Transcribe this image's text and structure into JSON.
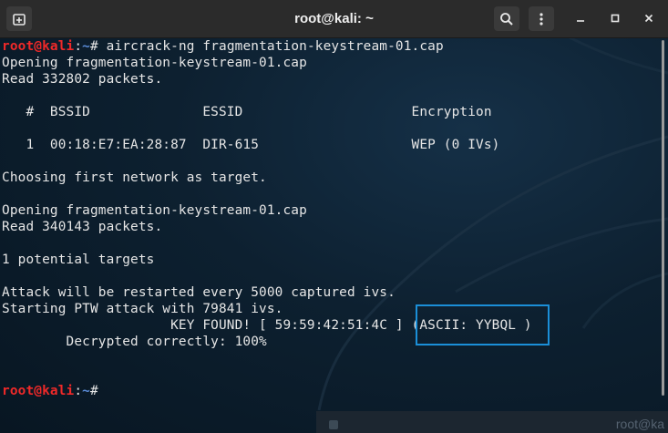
{
  "window": {
    "title": "root@kali: ~",
    "accent": "#1b8fd8"
  },
  "prompt": {
    "user_host": "root@kali",
    "path": "~",
    "symbol": "#"
  },
  "terminal": {
    "command": " aircrack-ng fragmentation-keystream-01.cap",
    "lines": [
      "Opening fragmentation-keystream-01.cap",
      "Read 332802 packets.",
      "",
      "   #  BSSID              ESSID                     Encryption",
      "",
      "   1  00:18:E7:EA:28:87  DIR-615                   WEP (0 IVs)",
      "",
      "Choosing first network as target.",
      "",
      "Opening fragmentation-keystream-01.cap",
      "Read 340143 packets.",
      "",
      "1 potential targets",
      "",
      "Attack will be restarted every 5000 captured ivs.",
      "Starting PTW attack with 79841 ivs.",
      "                     KEY FOUND! [ 59:59:42:51:4C ] (ASCII: YYBQL )",
      "\tDecrypted correctly: 100%"
    ]
  },
  "background_window": {
    "title_fragment": "root@ka"
  },
  "icons": {
    "new_tab": "new-tab-icon",
    "search": "search-icon",
    "menu": "kebab-menu-icon",
    "minimize": "minimize-icon",
    "maximize": "maximize-icon",
    "close": "close-icon"
  }
}
